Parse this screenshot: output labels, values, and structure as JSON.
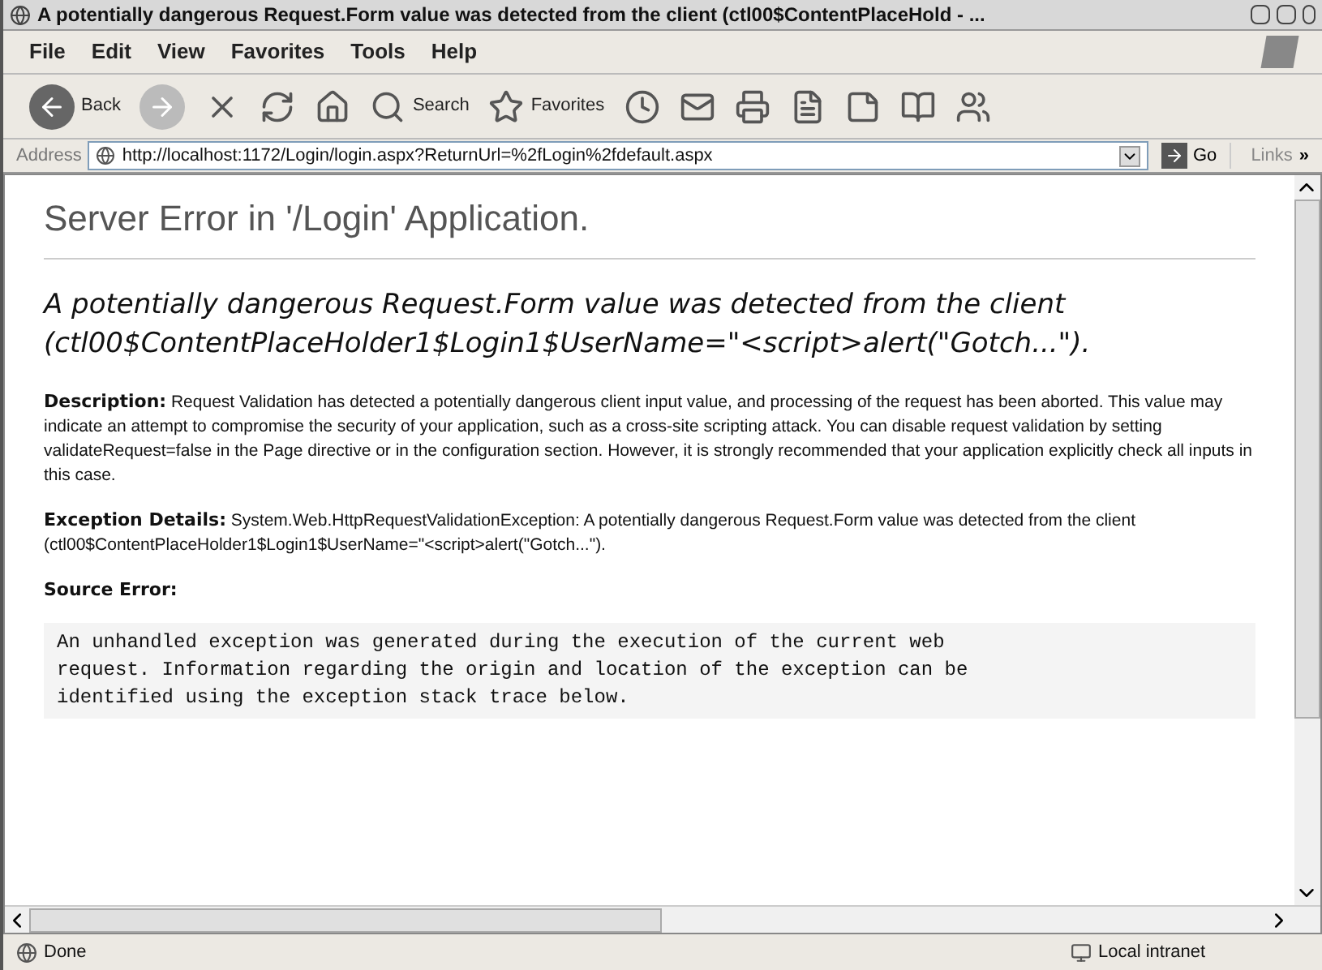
{
  "window": {
    "title": "A potentially dangerous Request.Form value was detected from the client (ctl00$ContentPlaceHold - ..."
  },
  "menu": [
    "File",
    "Edit",
    "View",
    "Favorites",
    "Tools",
    "Help"
  ],
  "toolbar": [
    {
      "kind": "back",
      "label": "Back"
    },
    {
      "kind": "forward"
    },
    {
      "kind": "stop"
    },
    {
      "kind": "refresh"
    },
    {
      "kind": "home"
    },
    {
      "kind": "search",
      "label": "Search"
    },
    {
      "kind": "favorites",
      "label": "Favorites"
    },
    {
      "kind": "history"
    },
    {
      "kind": "mail"
    },
    {
      "kind": "print"
    },
    {
      "kind": "edit"
    },
    {
      "kind": "discuss"
    },
    {
      "kind": "research"
    },
    {
      "kind": "messenger"
    }
  ],
  "address": {
    "label": "Address",
    "url": "http://localhost:1172/Login/login.aspx?ReturnUrl=%2fLogin%2fdefault.aspx",
    "go": "Go",
    "links": "Links",
    "more": "»"
  },
  "page": {
    "heading": "Server Error in '/Login' Application.",
    "message": "A potentially dangerous Request.Form value was detected from the client (ctl00$ContentPlaceHolder1$Login1$UserName=\"<script>alert(\"Gotch...\").",
    "sections": [
      {
        "label": "Description:",
        "text": "Request Validation has detected a potentially dangerous client input value, and processing of the request has been aborted. This value may indicate an attempt to compromise the security of your application, such as a cross-site scripting attack. You can disable request validation by setting validateRequest=false in the Page directive or in the configuration section. However, it is strongly recommended that your application explicitly check all inputs in this case."
      },
      {
        "label": "Exception Details:",
        "text": "System.Web.HttpRequestValidationException: A potentially dangerous Request.Form value was detected from the client (ctl00$ContentPlaceHolder1$Login1$UserName=\"<script>alert(\"Gotch...\")."
      },
      {
        "label": "Source Error:"
      }
    ],
    "source_code": [
      "An unhandled exception was generated during the execution of the current web",
      "request. Information regarding the origin and location of the exception can be",
      "identified using the exception stack trace below."
    ]
  },
  "status_bar": {
    "text": "Done",
    "zone": "Local intranet"
  }
}
